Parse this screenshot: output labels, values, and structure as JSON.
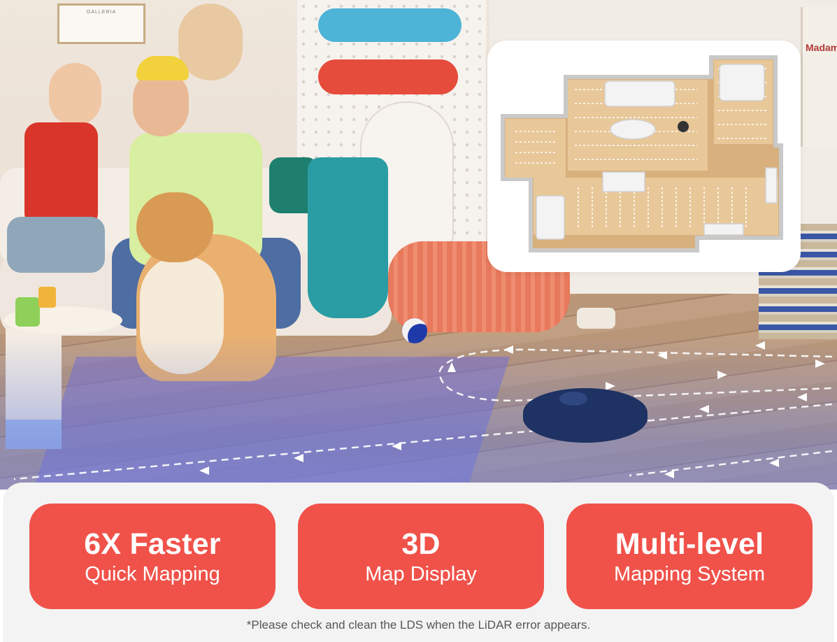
{
  "features": [
    {
      "title": "6X Faster",
      "subtitle": "Quick Mapping"
    },
    {
      "title": "3D",
      "subtitle": "Map Display"
    },
    {
      "title": "Multi-level",
      "subtitle": "Mapping System"
    }
  ],
  "footnote": "*Please check and clean the LDS when the LiDAR error appears.",
  "colors": {
    "feature_bg": "#f0524a",
    "panel_bg": "#f4f3f3",
    "robot": "#1e3263",
    "path_line": "#ffffff"
  },
  "hero": {
    "wall_frame_text": "GALLERIA",
    "poster_text": "Madam"
  }
}
